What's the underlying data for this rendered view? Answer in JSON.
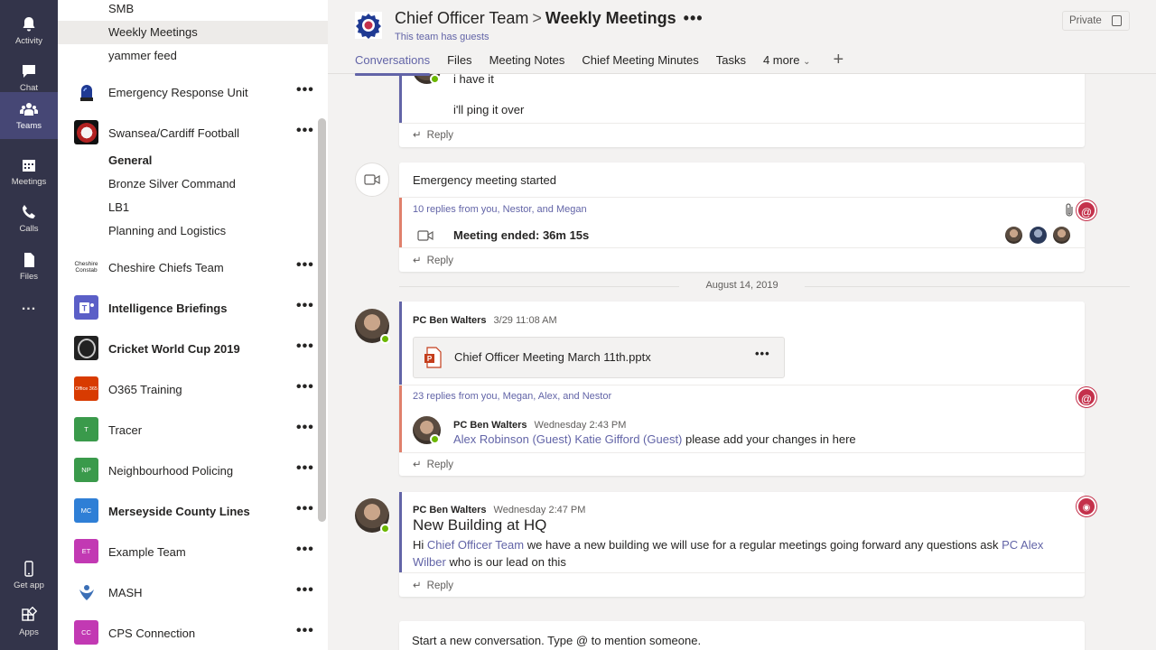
{
  "appbar": [
    {
      "label": "Activity",
      "icon": "bell-icon"
    },
    {
      "label": "Chat",
      "icon": "chat-icon"
    },
    {
      "label": "Teams",
      "icon": "teams-icon"
    },
    {
      "label": "Meetings",
      "icon": "calendar-icon"
    },
    {
      "label": "Calls",
      "icon": "phone-icon"
    },
    {
      "label": "Files",
      "icon": "file-icon"
    },
    {
      "label": "...",
      "icon": "more-icon"
    }
  ],
  "appbar_bottom": [
    {
      "label": "Get app",
      "icon": "mobile-icon"
    },
    {
      "label": "Apps",
      "icon": "apps-icon"
    }
  ],
  "sidebar": {
    "channels_top": [
      "SMB",
      "Weekly Meetings",
      "yammer feed"
    ],
    "teams": [
      {
        "name": "Emergency Response Unit",
        "avatar": "",
        "color": "#1f3a93"
      },
      {
        "name": "Swansea/Cardiff Football",
        "avatar": "",
        "color": "#8b1a1a"
      },
      {
        "name": "Cheshire Chiefs Team",
        "avatar": "Cheshire Constab",
        "color": "#ffffff"
      },
      {
        "name": "Intelligence Briefings",
        "avatar": "",
        "color": "#5b5fc7"
      },
      {
        "name": "Cricket World Cup 2019",
        "avatar": "",
        "color": "#222222"
      },
      {
        "name": "O365 Training",
        "avatar": "Office 365",
        "color": "#d83b01"
      },
      {
        "name": "Tracer",
        "avatar": "T",
        "color": "#3a9a4b"
      },
      {
        "name": "Neighbourhood Policing",
        "avatar": "NP",
        "color": "#3a9a4b"
      },
      {
        "name": "Merseyside County Lines",
        "avatar": "MC",
        "color": "#2f7fd6"
      },
      {
        "name": "Example Team",
        "avatar": "ET",
        "color": "#c239b3"
      },
      {
        "name": "MASH",
        "avatar": "",
        "color": "#ffffff"
      },
      {
        "name": "CPS Connection",
        "avatar": "CC",
        "color": "#c239b3"
      }
    ],
    "swansea_channels": [
      "General",
      "Bronze Silver Command",
      "LB1",
      "Planning and Logistics"
    ]
  },
  "header": {
    "team": "Chief Officer Team",
    "channel": "Weekly Meetings",
    "more": "•••",
    "guests": "This team has guests",
    "private_label": "Private",
    "tabs": [
      "Conversations",
      "Files",
      "Meeting Notes",
      "Chief Meeting Minutes",
      "Tasks",
      "4 more"
    ]
  },
  "thread1": {
    "lines": [
      "i have it",
      "i'll ping it over"
    ],
    "reply": "Reply"
  },
  "thread2": {
    "title": "Emergency meeting started",
    "replies": "10 replies from you, Nestor, and Megan",
    "meeting_ended": "Meeting ended: 36m 15s",
    "reply": "Reply"
  },
  "date_separator": "August 14, 2019",
  "thread3": {
    "sender": "PC Ben Walters",
    "time": "3/29 11:08 AM",
    "file_name": "Chief Officer Meeting March 11th.pptx",
    "replies": "23 replies from you, Megan, Alex, and Nestor",
    "reply_sender": "PC Ben Walters",
    "reply_time": "Wednesday 2:43 PM",
    "mention1": "Alex Robinson (Guest)",
    "mention2": "Katie Gifford (Guest)",
    "reply_text": "please add your changes in here",
    "reply": "Reply"
  },
  "thread4": {
    "sender": "PC Ben Walters",
    "time": "Wednesday 2:47 PM",
    "subject": "New Building at HQ",
    "hi": "Hi",
    "mention_team": "Chief Officer Team",
    "body1": "we have a new building we will use for a regular meetings going forward any questions ask",
    "mention_person_a": "PC Alex",
    "mention_person_b": "Wilber",
    "body2": "who is our lead on this",
    "reply": "Reply"
  },
  "compose": {
    "placeholder": "Start a new conversation. Type @ to mention someone."
  }
}
